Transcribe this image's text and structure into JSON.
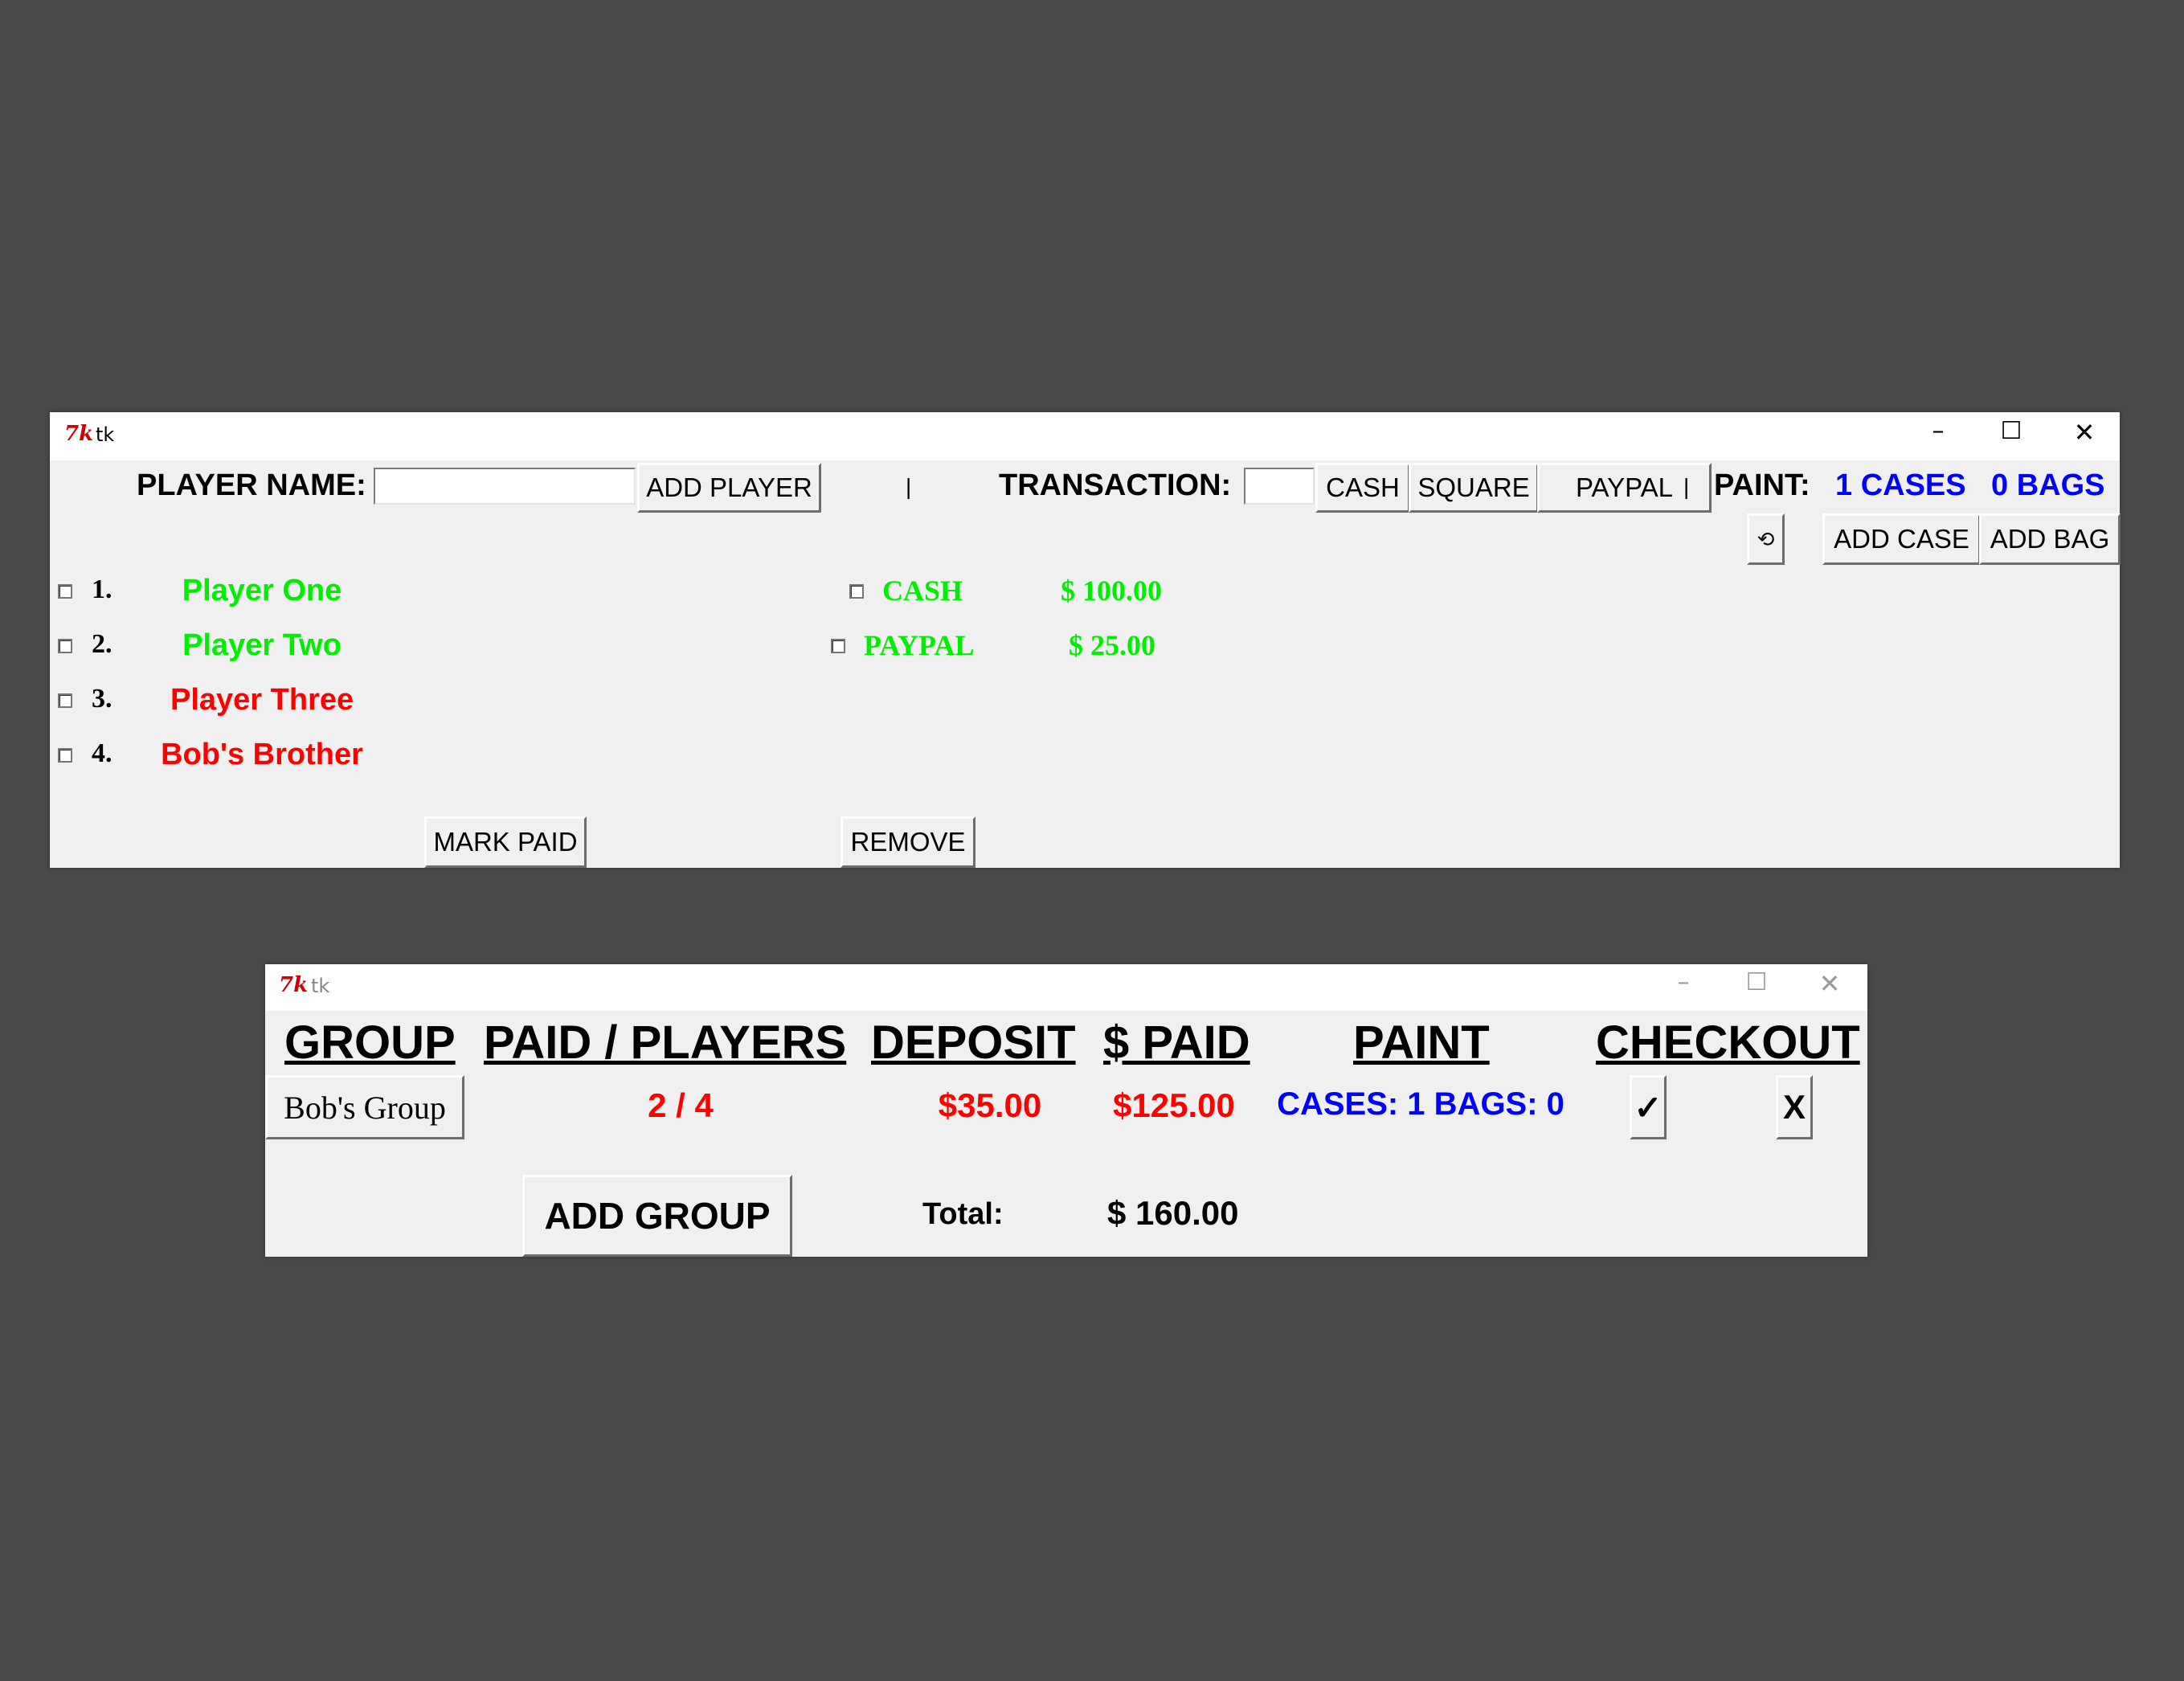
{
  "colors": {
    "desktop": "#4b4a48",
    "paid_green": "#00ee00",
    "unpaid_red": "#ff0000",
    "paint_blue": "#0000ff"
  },
  "window1": {
    "title": "tk",
    "player_name_label": "PLAYER NAME:",
    "player_name_value": "",
    "add_player_label": "ADD PLAYER",
    "separator1": "|",
    "transaction_label": "TRANSACTION:",
    "transaction_value": "",
    "cash_label": "CASH",
    "square_label": "SQUARE",
    "paypal_label": "PAYPAL",
    "separator2": "|",
    "paint_label": "PAINT:",
    "paint_cases": "1 CASES",
    "paint_bags": "0 BAGS",
    "reset_glyph": "⟲",
    "add_case_label": "ADD CASE",
    "add_bag_label": "ADD BAG",
    "players": [
      {
        "num": "1.",
        "name": "Player One",
        "status": "paid"
      },
      {
        "num": "2.",
        "name": "Player Two",
        "status": "paid"
      },
      {
        "num": "3.",
        "name": "Player Three",
        "status": "unpaid"
      },
      {
        "num": "4.",
        "name": "Bob's Brother",
        "status": "unpaid"
      }
    ],
    "transactions": [
      {
        "method": "CASH",
        "amount": "$ 100.00"
      },
      {
        "method": "PAYPAL",
        "amount": "$ 25.00"
      }
    ],
    "mark_paid_label": "MARK PAID",
    "remove_label": "REMOVE"
  },
  "window2": {
    "title": "tk",
    "headers": {
      "group": "GROUP",
      "paid_players": "PAID / PLAYERS",
      "deposit": "DEPOSIT",
      "paid": "$ PAID",
      "paint": "PAINT",
      "checkout": "CHECKOUT"
    },
    "rows": [
      {
        "group": "Bob's Group",
        "paid_players": "2 / 4",
        "deposit": "$35.00",
        "paid": "$125.00",
        "paint": "CASES: 1 BAGS: 0",
        "check": "✓",
        "x": "X"
      }
    ],
    "add_group_label": "ADD GROUP",
    "total_label": "Total:",
    "total_value": "$ 160.00"
  }
}
